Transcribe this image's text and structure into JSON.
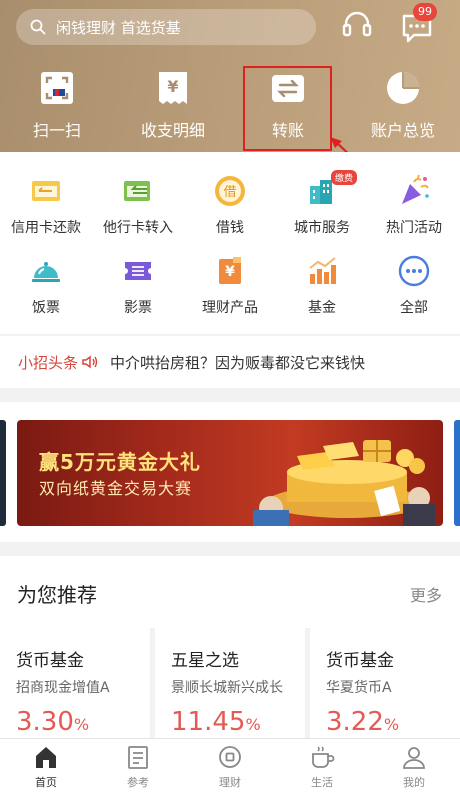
{
  "search": {
    "placeholder": "闲钱理财 首选货基"
  },
  "header": {
    "message_badge": "99"
  },
  "quick_actions": [
    {
      "label": "扫一扫",
      "icon": "scan-icon"
    },
    {
      "label": "收支明细",
      "icon": "receipt-icon"
    },
    {
      "label": "转账",
      "icon": "transfer-icon"
    },
    {
      "label": "账户总览",
      "icon": "pie-chart-icon"
    }
  ],
  "services": [
    {
      "label": "信用卡还款",
      "icon": "credit-card-icon"
    },
    {
      "label": "他行卡转入",
      "icon": "card-transfer-in-icon"
    },
    {
      "label": "借钱",
      "icon": "borrow-icon"
    },
    {
      "label": "城市服务",
      "icon": "city-icon",
      "tag": "缴费"
    },
    {
      "label": "热门活动",
      "icon": "party-popper-icon"
    },
    {
      "label": "饭票",
      "icon": "meal-bell-icon"
    },
    {
      "label": "影票",
      "icon": "ticket-icon"
    },
    {
      "label": "理财产品",
      "icon": "wealth-product-icon"
    },
    {
      "label": "基金",
      "icon": "bar-chart-icon"
    },
    {
      "label": "全部",
      "icon": "more-icon"
    }
  ],
  "headline": {
    "tag": "小招头条",
    "text": "中介哄抬房租？因为贩毒都没它来钱快"
  },
  "banner": {
    "title": "赢5万元黄金大礼",
    "subtitle": "双向纸黄金交易大赛"
  },
  "recommend": {
    "title": "为您推荐",
    "more": "更多",
    "cards": [
      {
        "category": "货币基金",
        "name": "招商现金增值A",
        "rate": "3.30",
        "unit": "%"
      },
      {
        "category": "五星之选",
        "name": "景顺长城新兴成长",
        "rate": "11.45",
        "unit": "%"
      },
      {
        "category": "货币基金",
        "name": "华夏货币A",
        "rate": "3.22",
        "unit": "%"
      }
    ]
  },
  "tabs": [
    {
      "label": "首页",
      "icon": "home-icon",
      "active": true
    },
    {
      "label": "参考",
      "icon": "reference-icon"
    },
    {
      "label": "理财",
      "icon": "wealth-icon"
    },
    {
      "label": "生活",
      "icon": "coffee-icon"
    },
    {
      "label": "我的",
      "icon": "user-icon"
    }
  ],
  "colors": {
    "header": "#b89c78",
    "accent_red": "#e25c55",
    "highlight": "#e02020"
  }
}
